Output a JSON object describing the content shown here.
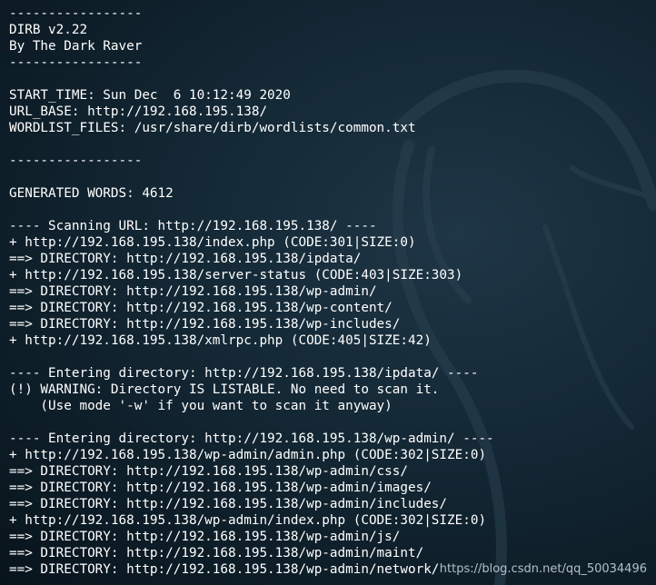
{
  "terminal": {
    "lines": [
      "-----------------",
      "DIRB v2.22",
      "By The Dark Raver",
      "-----------------",
      "",
      "START_TIME: Sun Dec  6 10:12:49 2020",
      "URL_BASE: http://192.168.195.138/",
      "WORDLIST_FILES: /usr/share/dirb/wordlists/common.txt",
      "",
      "-----------------",
      "",
      "GENERATED WORDS: 4612",
      "",
      "---- Scanning URL: http://192.168.195.138/ ----",
      "+ http://192.168.195.138/index.php (CODE:301|SIZE:0)",
      "==> DIRECTORY: http://192.168.195.138/ipdata/",
      "+ http://192.168.195.138/server-status (CODE:403|SIZE:303)",
      "==> DIRECTORY: http://192.168.195.138/wp-admin/",
      "==> DIRECTORY: http://192.168.195.138/wp-content/",
      "==> DIRECTORY: http://192.168.195.138/wp-includes/",
      "+ http://192.168.195.138/xmlrpc.php (CODE:405|SIZE:42)",
      "",
      "---- Entering directory: http://192.168.195.138/ipdata/ ----",
      "(!) WARNING: Directory IS LISTABLE. No need to scan it.",
      "    (Use mode '-w' if you want to scan it anyway)",
      "",
      "---- Entering directory: http://192.168.195.138/wp-admin/ ----",
      "+ http://192.168.195.138/wp-admin/admin.php (CODE:302|SIZE:0)",
      "==> DIRECTORY: http://192.168.195.138/wp-admin/css/",
      "==> DIRECTORY: http://192.168.195.138/wp-admin/images/",
      "==> DIRECTORY: http://192.168.195.138/wp-admin/includes/",
      "+ http://192.168.195.138/wp-admin/index.php (CODE:302|SIZE:0)",
      "==> DIRECTORY: http://192.168.195.138/wp-admin/js/",
      "==> DIRECTORY: http://192.168.195.138/wp-admin/maint/",
      "==> DIRECTORY: http://192.168.195.138/wp-admin/network/"
    ]
  },
  "watermark": "https://blog.csdn.net/qq_50034496",
  "colors": {
    "background": "#0b1a24",
    "text": "#ffffff"
  }
}
